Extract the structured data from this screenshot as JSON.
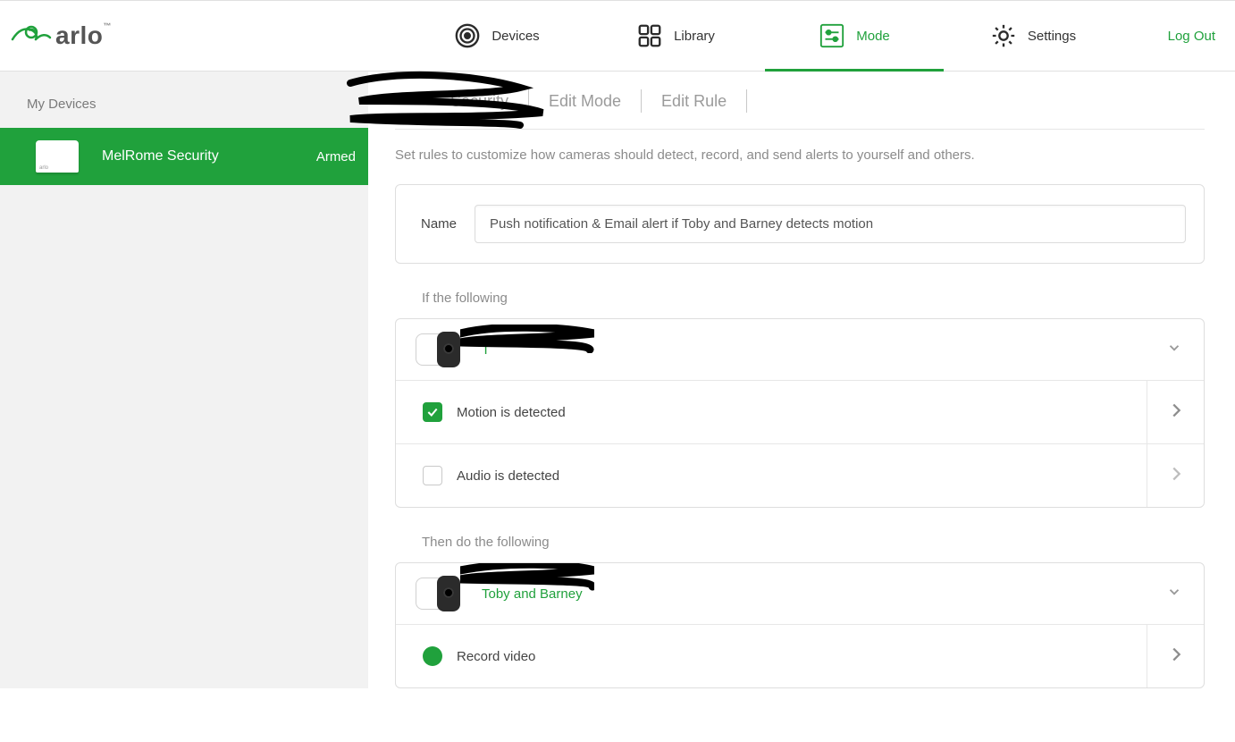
{
  "brand": {
    "name": "arlo"
  },
  "nav": {
    "devices": "Devices",
    "library": "Library",
    "mode": "Mode",
    "settings": "Settings",
    "active": "mode"
  },
  "logout": "Log Out",
  "sidebar": {
    "heading": "My Devices",
    "device": {
      "name": "MelRome Security",
      "status": "Armed"
    }
  },
  "breadcrumb": {
    "root": "Security",
    "edit_mode": "Edit Mode",
    "edit_rule": "Edit Rule"
  },
  "description": "Set rules to customize how cameras should detect, record, and send alerts to yourself and others.",
  "rule": {
    "name_label": "Name",
    "name_value": "Push notification & Email alert if Toby and Barney detects motion"
  },
  "if_section": {
    "heading": "If the following",
    "camera_label": "T",
    "motion": {
      "label": "Motion is detected",
      "checked": true
    },
    "audio": {
      "label": "Audio is detected",
      "checked": false
    }
  },
  "then_section": {
    "heading": "Then do the following",
    "camera_label": "Toby and Barney",
    "record": {
      "label": "Record video",
      "selected": true
    }
  }
}
